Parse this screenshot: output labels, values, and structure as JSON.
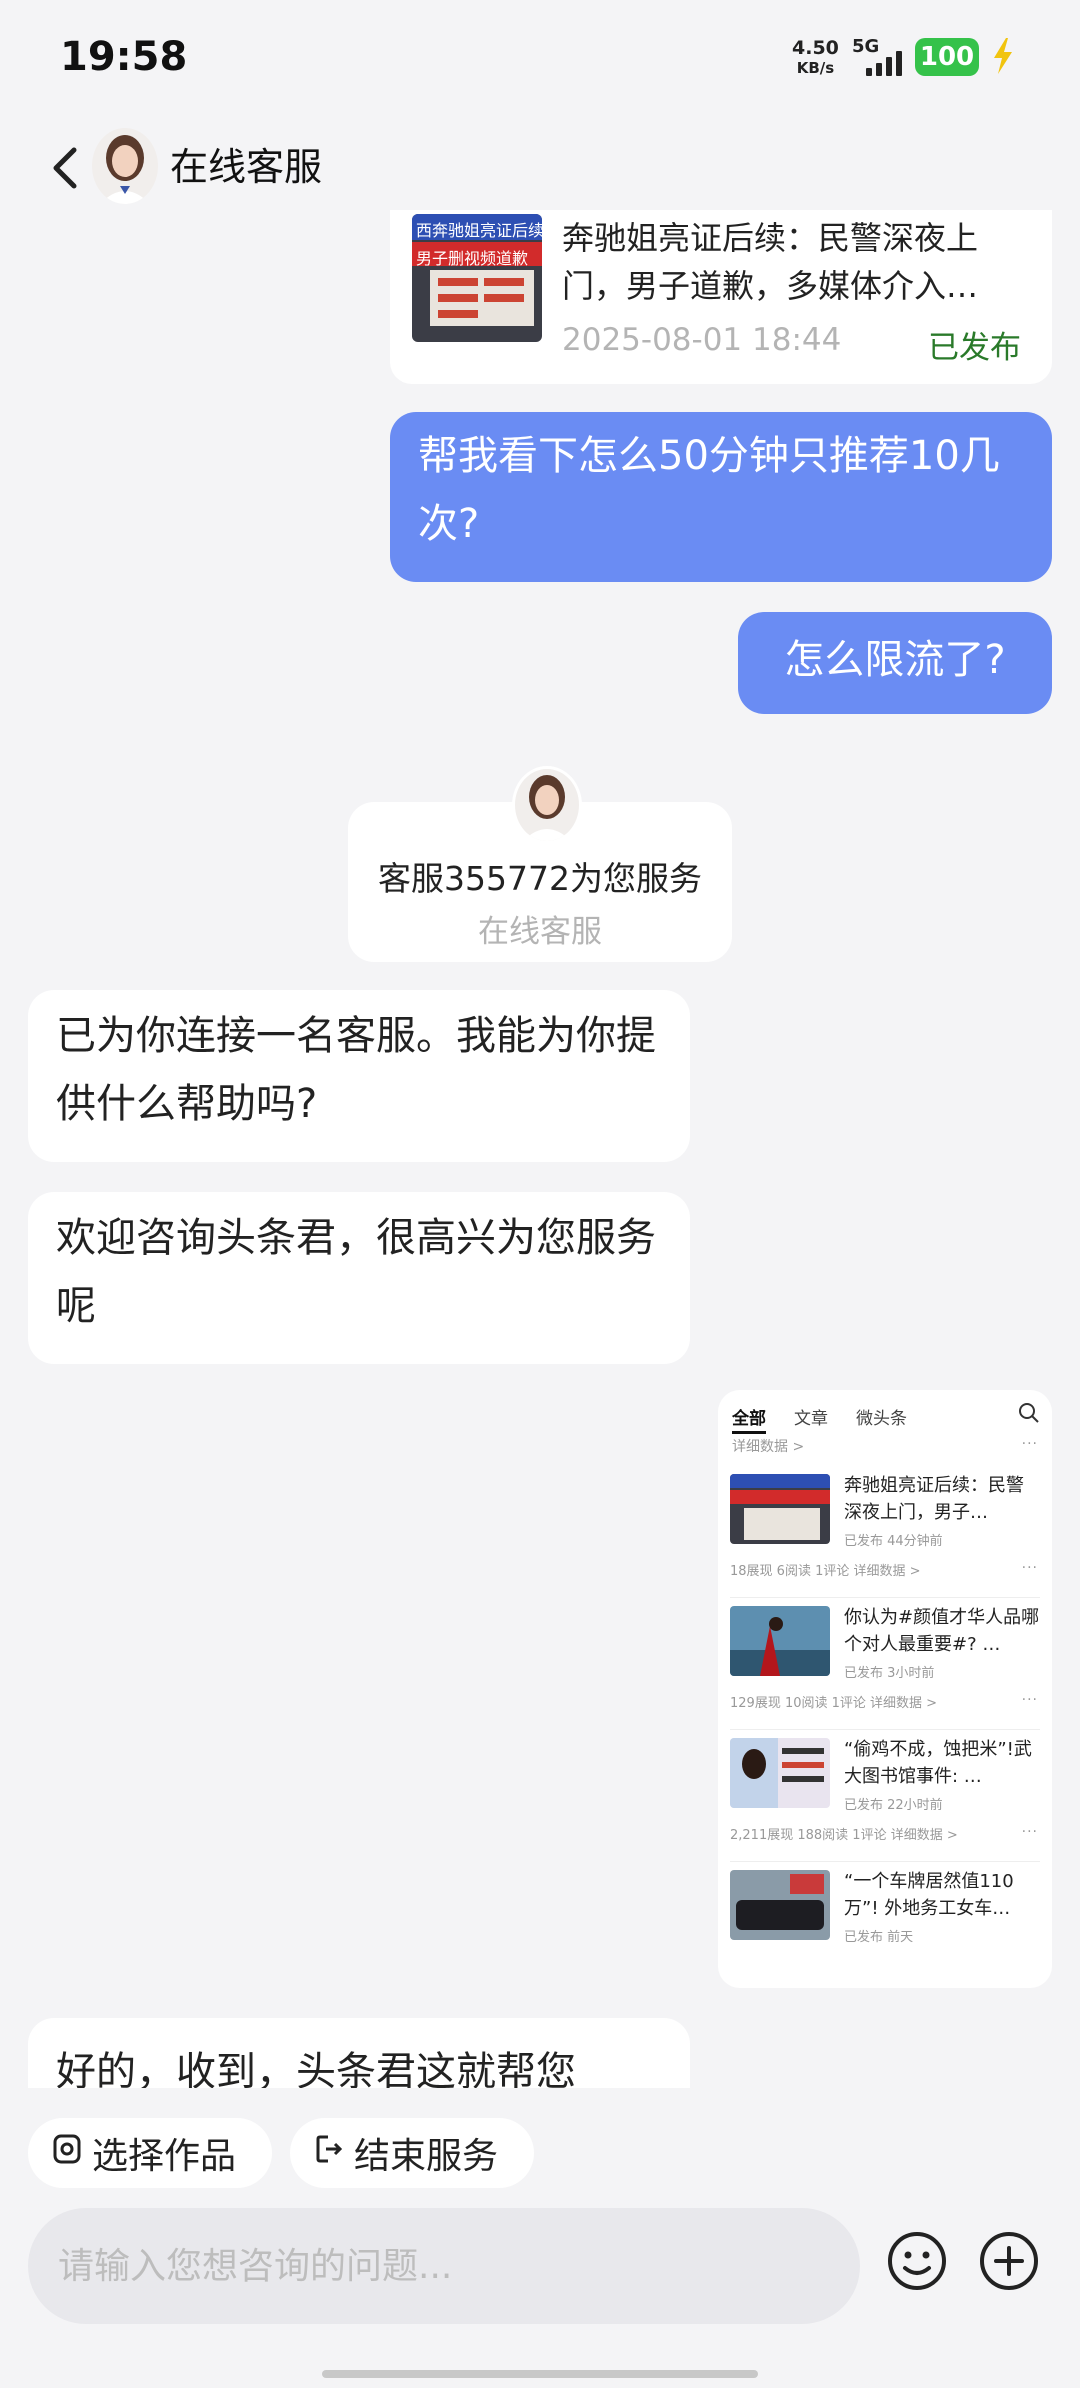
{
  "status_bar": {
    "time": "19:58",
    "net_speed_value": "4.50",
    "net_speed_unit": "KB/s",
    "network": "5G",
    "battery": "100"
  },
  "header": {
    "title": "在线客服"
  },
  "chat": {
    "article": {
      "title": "奔驰姐亮证后续：民警深夜上门，男子道歉，多媒体介入…",
      "date": "2025-08-01 18:44",
      "status": "已发布",
      "thumb_title": "西奔驰姐亮证后续",
      "thumb_sub": "男子删视频道歉"
    },
    "user_msg_1": "帮我看下怎么50分钟只推荐10几次?",
    "user_msg_2": "怎么限流了?",
    "agent_card": {
      "name": "客服355772为您服务",
      "role": "在线客服"
    },
    "agent_msg_1": "已为你连接一名客服。我能为你提供什么帮助吗?",
    "agent_msg_2": "欢迎咨询头条君，很高兴为您服务呢",
    "agent_msg_3": "好的，收到，头条君这就帮您"
  },
  "screenshot": {
    "tabs": [
      "全部",
      "文章",
      "微头条"
    ],
    "top_detail": "详细数据 >",
    "items": [
      {
        "title": "奔驰姐亮证后续：民警深夜上门，男子…",
        "meta": "已发布  44分钟前",
        "stats": "18展现  6阅读  1评论  详细数据 >"
      },
      {
        "title": "你认为#颜值才华人品哪个对人最重要#? …",
        "meta": "已发布  3小时前",
        "stats": "129展现  10阅读  1评论  详细数据 >"
      },
      {
        "title": "“偷鸡不成，蚀把米”!武大图书馆事件: …",
        "meta": "已发布  22小时前",
        "stats": "2,211展现  188阅读  1评论  详细数据 >"
      },
      {
        "title": "“一个车牌居然值110万”! 外地务工女车…",
        "meta": "已发布  前天",
        "stats": ""
      }
    ]
  },
  "bottom": {
    "select_label": "选择作品",
    "end_label": "结束服务",
    "input_placeholder": "请输入您想咨询的问题..."
  },
  "icons": {
    "back": "chevron-left-icon",
    "emoji": "emoji-icon",
    "plus": "plus-icon",
    "select": "works-icon",
    "end": "exit-icon"
  },
  "colors": {
    "user_bubble": "#6a8cf3",
    "background": "#f4f4f6",
    "published": "#2a7a2a",
    "battery": "#35c24a"
  }
}
